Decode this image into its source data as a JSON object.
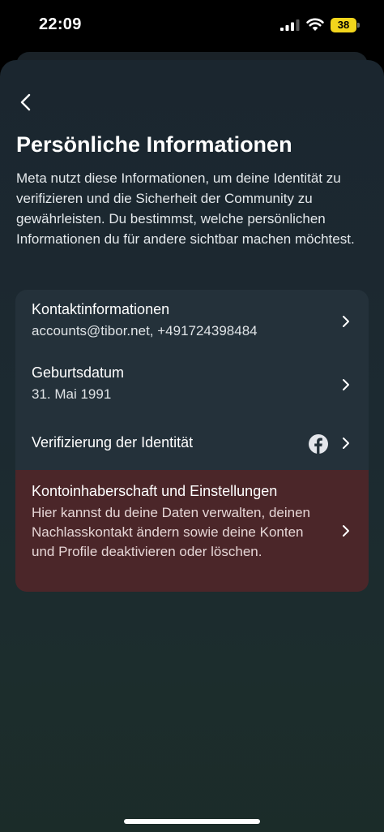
{
  "status_bar": {
    "time": "22:09",
    "battery": "38",
    "icons": [
      "cellular-signal-icon",
      "wifi-icon",
      "battery-icon"
    ]
  },
  "header": {
    "back_icon": "chevron-left-icon",
    "title": "Persönliche Informationen",
    "description": "Meta nutzt diese Informationen, um deine Identität zu verifizieren und die Sicherheit der Community zu gewährleisten. Du bestimmst, welche persönlichen Informationen du für andere sichtbar machen möchtest."
  },
  "items": {
    "contact": {
      "title": "Kontaktinformationen",
      "subtitle": "accounts@tibor.net, +491724398484"
    },
    "birthday": {
      "title": "Geburtsdatum",
      "subtitle": "31. Mai 1991"
    },
    "identity": {
      "title": "Verifizierung der Identität",
      "icon": "facebook-icon"
    },
    "account": {
      "title": "Kontoinhaberschaft und Einstellungen",
      "description": "Hier kannst du deine Daten verwalten, deinen Nachlasskontakt ändern sowie deine Konten und Profile deaktivieren oder löschen."
    }
  },
  "colors": {
    "card_background": "#24313a",
    "highlight_row": "#4b2629",
    "battery": "#f2d51c"
  }
}
